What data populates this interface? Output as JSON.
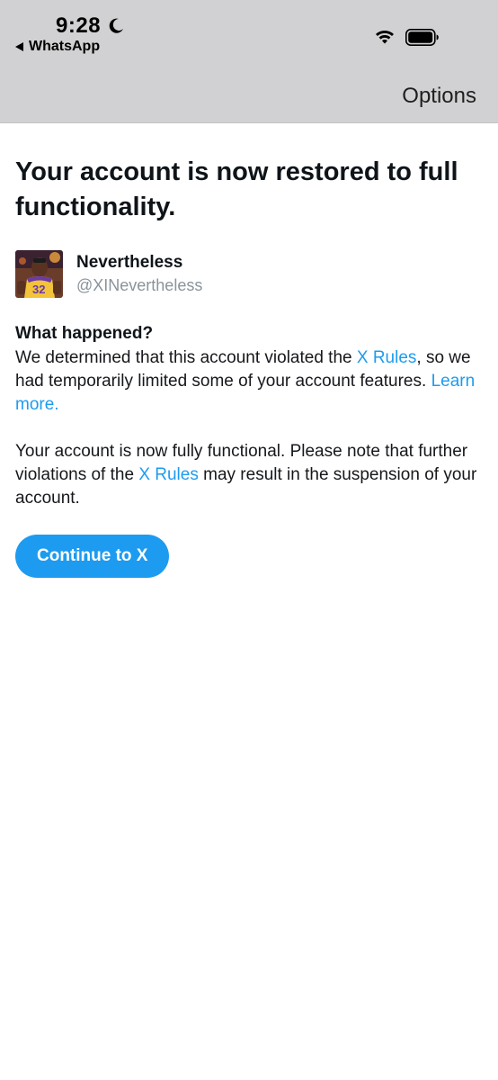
{
  "status_bar": {
    "time": "9:28",
    "back_app": "WhatsApp"
  },
  "nav": {
    "options_label": "Options"
  },
  "page": {
    "title": "Your account is now restored to full functionality.",
    "user": {
      "name": "Nevertheless",
      "handle": "@XINevertheless"
    },
    "what_happened_heading": "What happened?",
    "para1": {
      "before": "We determined that this account violated the ",
      "link1": "X Rules",
      "middle": ", so we had temporarily limited some of your account features. ",
      "link2": "Learn more."
    },
    "para2": {
      "before": "Your account is now fully functional. Please note that further violations of the ",
      "link": "X Rules",
      "after": " may result in the suspension of your account."
    },
    "continue_label": "Continue to X"
  },
  "colors": {
    "accent": "#1d9bf0",
    "topbar": "#d1d1d3"
  }
}
